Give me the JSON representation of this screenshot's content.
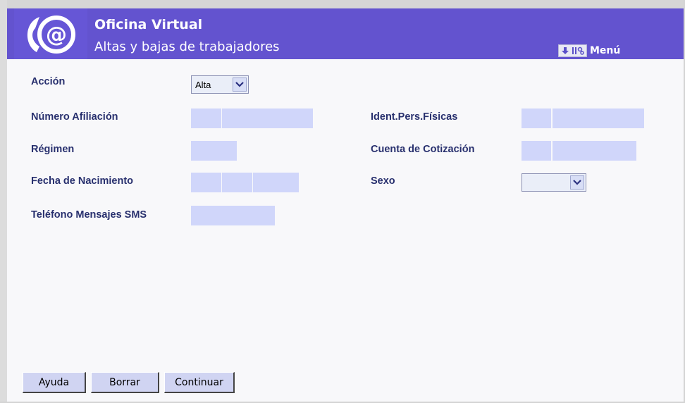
{
  "header": {
    "title": "Oficina Virtual",
    "subtitle": "Altas y bajas de trabajadores",
    "menu_label": "Menú",
    "logo_icon": "at-sign-logo-icon",
    "colors": {
      "header": "#6353cf",
      "field": "#d0d6fa",
      "label": "#28306e"
    }
  },
  "form": {
    "accion": {
      "label": "Acción",
      "selected": "Alta"
    },
    "numero_afiliacion": {
      "label": "Número Afiliación",
      "values": [
        "",
        ""
      ]
    },
    "ident_pers_fisicas": {
      "label": "Ident.Pers.Físicas",
      "values": [
        "",
        ""
      ]
    },
    "regimen": {
      "label": "Régimen",
      "value": ""
    },
    "cuenta_cotizacion": {
      "label": "Cuenta de Cotización",
      "values": [
        "",
        ""
      ]
    },
    "fecha_nacimiento": {
      "label": "Fecha de Nacimiento",
      "values": [
        "",
        "",
        ""
      ]
    },
    "sexo": {
      "label": "Sexo",
      "selected": ""
    },
    "telefono_sms": {
      "label": "Teléfono Mensajes SMS",
      "value": ""
    }
  },
  "buttons": {
    "ayuda": "Ayuda",
    "borrar": "Borrar",
    "continuar": "Continuar"
  }
}
